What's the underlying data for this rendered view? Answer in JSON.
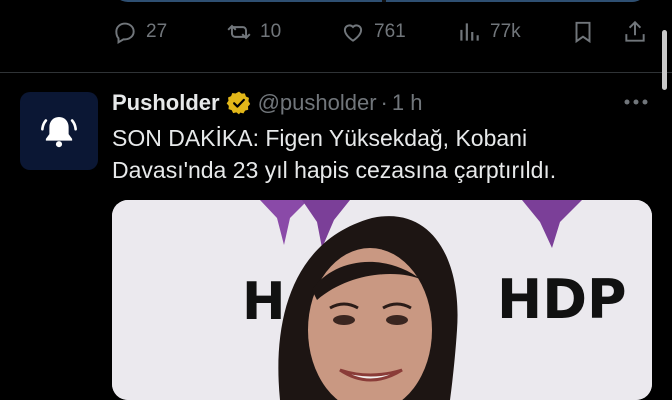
{
  "previous_tweet": {
    "actions": [
      {
        "name": "reply",
        "icon": "reply-icon",
        "count": "27"
      },
      {
        "name": "retweet",
        "icon": "retweet-icon",
        "count": "10"
      },
      {
        "name": "like",
        "icon": "heart-icon",
        "count": "761"
      },
      {
        "name": "views",
        "icon": "views-icon",
        "count": "77k"
      },
      {
        "name": "bookmark",
        "icon": "bookmark-icon",
        "count": ""
      },
      {
        "name": "share",
        "icon": "share-icon",
        "count": ""
      }
    ]
  },
  "tweet": {
    "avatar_icon": "bell-icon",
    "display_name": "Pusholder",
    "verified_badge": "verified-gold-icon",
    "handle": "@pusholder",
    "separator": "·",
    "time": "1 h",
    "more_icon": "more-dots-icon",
    "text_line1": "SON DAKİKA: Figen Yüksekdağ, Kobani",
    "text_line2": "Davası'nda 23 yıl hapis cezasına çarptırıldı.",
    "photo": {
      "sign_left": "H",
      "sign_right": "HDP"
    }
  },
  "colors": {
    "background": "#000000",
    "text_primary": "#e7e9ea",
    "text_secondary": "#71767b",
    "divider": "#2f3336",
    "verified_gold": "#e2b719",
    "avatar_bg": "#0b1734",
    "hdp_purple": "#7b3f98"
  }
}
